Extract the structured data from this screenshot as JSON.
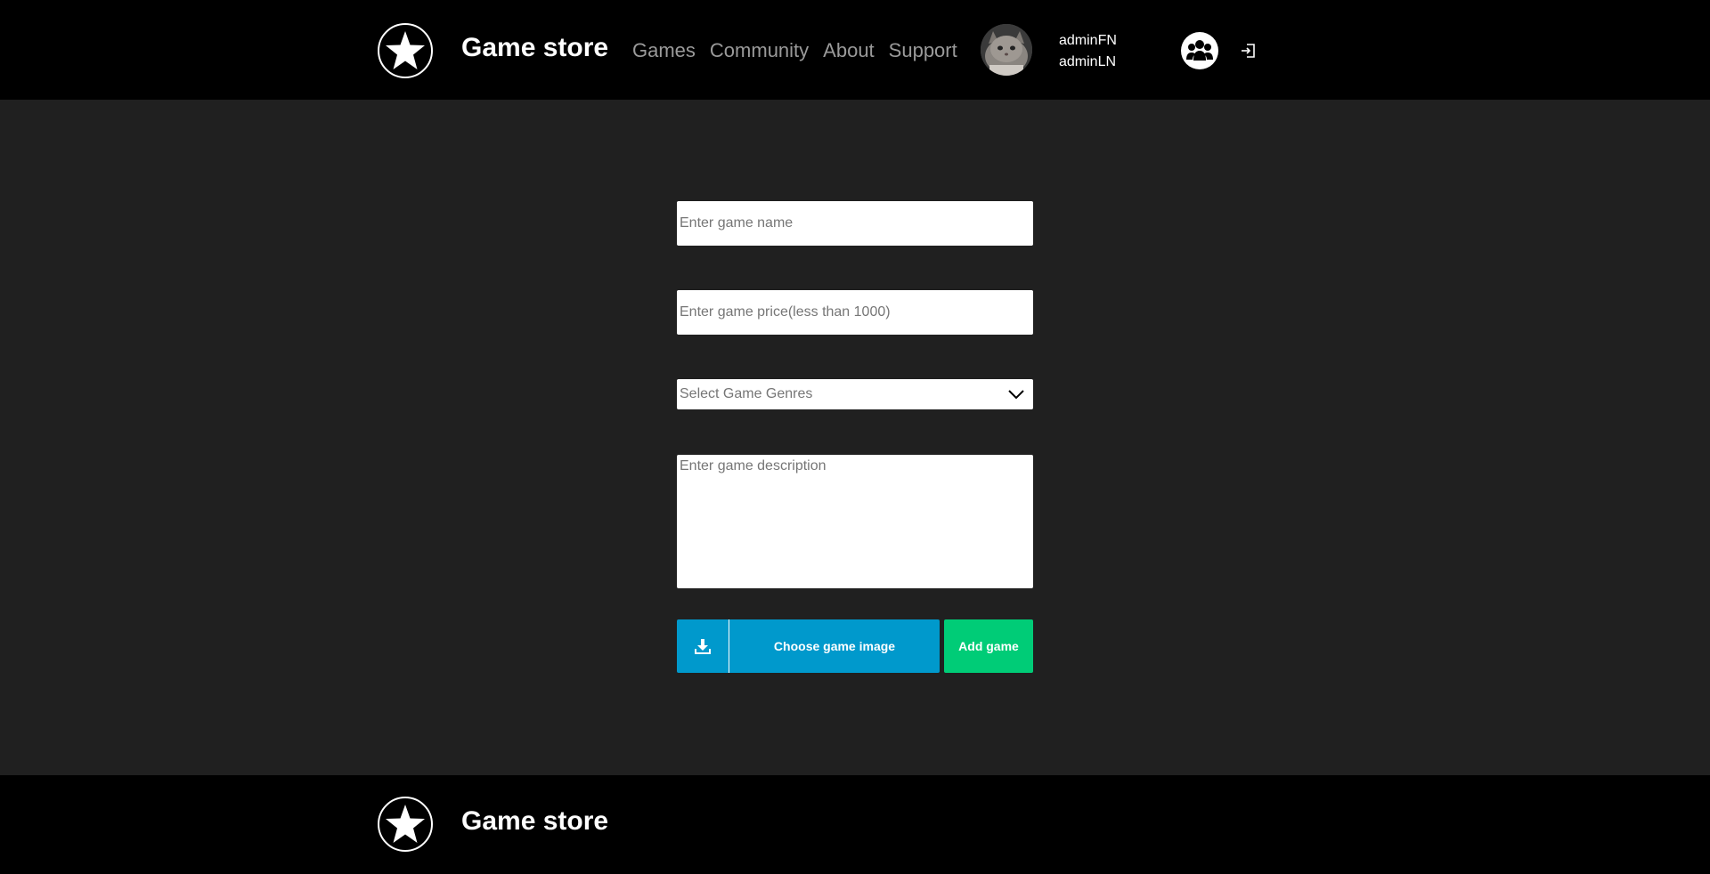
{
  "header": {
    "brand": "Game store",
    "nav": [
      {
        "label": "Games"
      },
      {
        "label": "Community"
      },
      {
        "label": "About"
      },
      {
        "label": "Support"
      }
    ],
    "user": {
      "first_name": "adminFN",
      "last_name": "adminLN"
    },
    "icons": {
      "logo": "star-icon",
      "community": "community-icon",
      "logout": "logout-icon"
    }
  },
  "form": {
    "name_placeholder": "Enter game name",
    "price_placeholder": "Enter game price(less than 1000)",
    "genre_placeholder": "Select Game Genres",
    "description_placeholder": "Enter game description",
    "image_button_label": "Choose game image",
    "add_button_label": "Add game"
  },
  "footer": {
    "brand": "Game store"
  },
  "colors": {
    "background": "#202020",
    "header": "#000000",
    "image_button": "#0099cc",
    "add_button": "#00cc77"
  }
}
